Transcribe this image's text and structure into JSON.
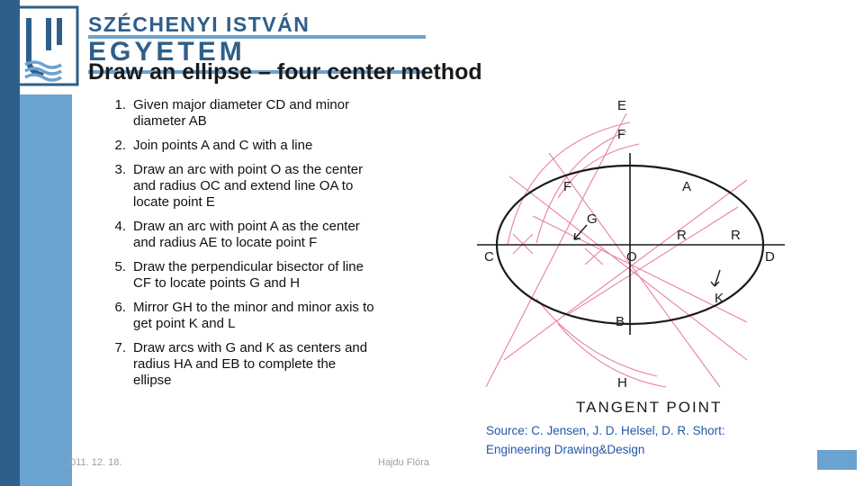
{
  "logo": {
    "line1": "SZÉCHENYI ISTVÁN",
    "line2": "EGYETEM",
    "mark": "university-logo-mark"
  },
  "title": "Draw an ellipse – four center method",
  "steps": [
    {
      "num": "1.",
      "text": "Given major diameter CD and minor diameter AB"
    },
    {
      "num": "2.",
      "text": "Join points A and C with a line"
    },
    {
      "num": "3.",
      "text": "Draw an arc with point O as the center and radius OC and extend line OA to locate point E"
    },
    {
      "num": "4.",
      "text": "Draw an arc with point A as the center and radius AE to locate point F"
    },
    {
      "num": "5.",
      "text": "Draw the perpendicular bisector of line CF to locate points G and H"
    },
    {
      "num": "6.",
      "text": "Mirror GH to the minor and minor axis to get point K and L"
    },
    {
      "num": "7.",
      "text": "Draw arcs with G and K as centers  and radius HA and EB to complete the ellipse"
    }
  ],
  "figure": {
    "caption": "TANGENT POINT",
    "labels": {
      "e_outer": "E",
      "f_outer": "F",
      "a": "A",
      "f_inner": "F",
      "g": "G",
      "r_left": "R",
      "r_right": "R",
      "c": "C",
      "o": "O",
      "d": "D",
      "k": "K",
      "b": "B",
      "h": "H"
    }
  },
  "source": {
    "line1": "Source: C. Jensen, J. D. Helsel, D. R. Short:",
    "line2": "Engineering Drawing&Design"
  },
  "footer": {
    "date": "2011. 12. 18.",
    "author": "Hajdu Flóra"
  },
  "colors": {
    "brand_dark_blue": "#2e5f8a",
    "brand_light_blue": "#6ba3d0",
    "source_text": "#2257a8",
    "figure_construction": "#e8809f"
  }
}
